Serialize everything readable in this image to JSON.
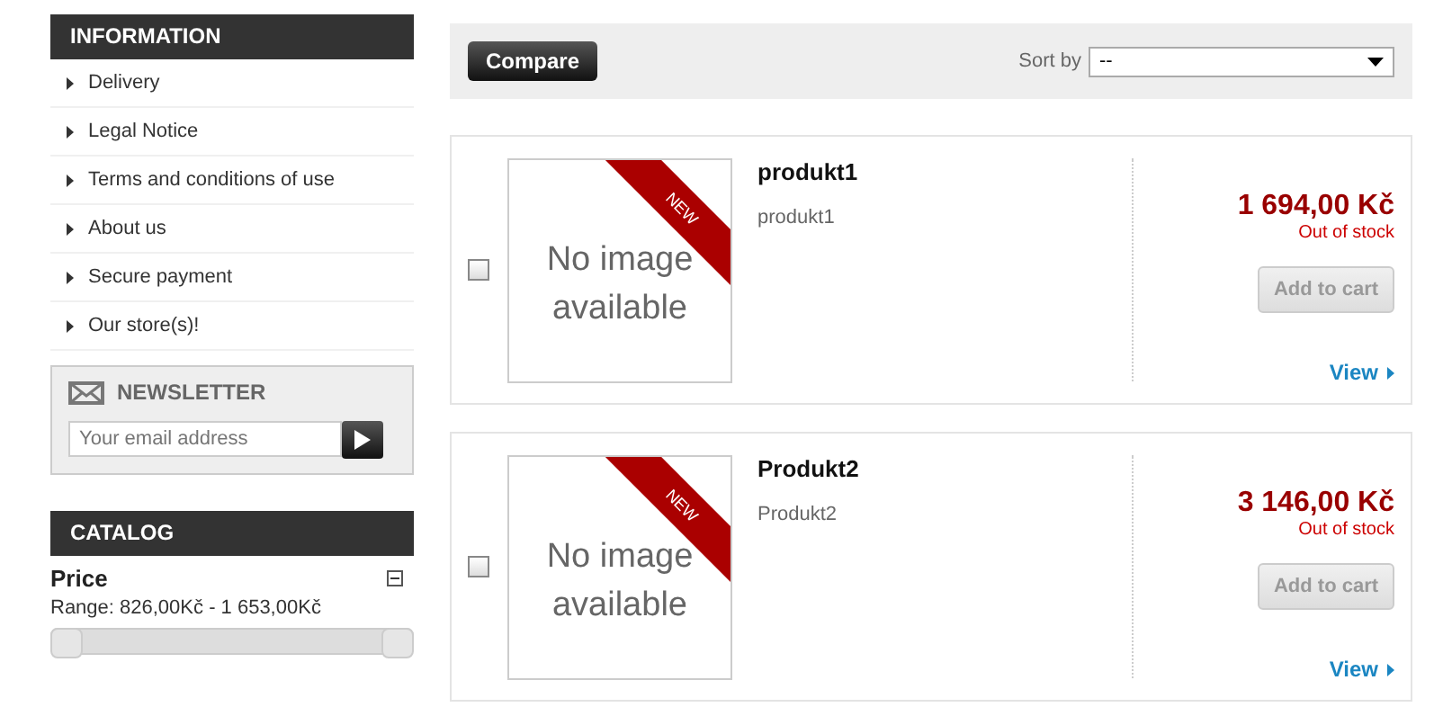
{
  "information": {
    "title": "INFORMATION",
    "items": [
      "Delivery",
      "Legal Notice",
      "Terms and conditions of use",
      "About us",
      "Secure payment",
      "Our store(s)!"
    ]
  },
  "newsletter": {
    "title": "NEWSLETTER",
    "placeholder": "Your email address"
  },
  "catalog": {
    "title": "CATALOG",
    "filter": "Price",
    "range": "Range: 826,00Kč - 1 653,00Kč",
    "level": 1
  },
  "toolbar": {
    "compare": "Compare",
    "sort_label": "Sort by",
    "sort_value": "--"
  },
  "products": [
    {
      "name": "produkt1",
      "description": "produkt1",
      "image_text": [
        "No image",
        "available"
      ],
      "badge": "NEW",
      "price": "1 694,00 Kč",
      "availability": "Out of stock",
      "cart": "Add to cart",
      "cart_disabled": true,
      "view": "View",
      "checked": false
    },
    {
      "name": "Produkt2",
      "description": "Produkt2",
      "image_text": [
        "No image",
        "available"
      ],
      "badge": "NEW",
      "price": "3 146,00 Kč",
      "availability": "Out of stock",
      "cart": "Add to cart",
      "cart_disabled": true,
      "view": "View",
      "checked": false
    }
  ]
}
